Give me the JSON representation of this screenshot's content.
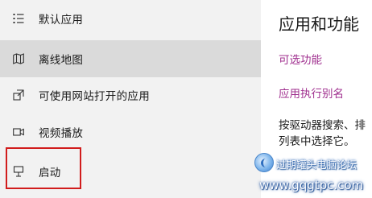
{
  "sidebar": {
    "items": [
      {
        "label": "默认应用",
        "icon": "default-apps-icon",
        "selected": false
      },
      {
        "label": "离线地图",
        "icon": "offline-maps-icon",
        "selected": true
      },
      {
        "label": "可使用网站打开的应用",
        "icon": "apps-for-websites-icon",
        "selected": false
      },
      {
        "label": "视频播放",
        "icon": "video-playback-icon",
        "selected": false
      },
      {
        "label": "启动",
        "icon": "startup-icon",
        "selected": false
      }
    ]
  },
  "content": {
    "title": "应用和功能",
    "links": [
      "可选功能",
      "应用执行别名"
    ],
    "description_lines": [
      "按驱动器搜索、排",
      "列表中选择它。"
    ]
  },
  "watermark": {
    "title": "过期罐头电脑论坛",
    "url": "www.gqgtpc.com"
  },
  "colors": {
    "link": "#a0308f",
    "sidebar_bg": "#f2f2f2",
    "selected_bg": "#dadada",
    "highlight_border": "#d11c1c"
  }
}
